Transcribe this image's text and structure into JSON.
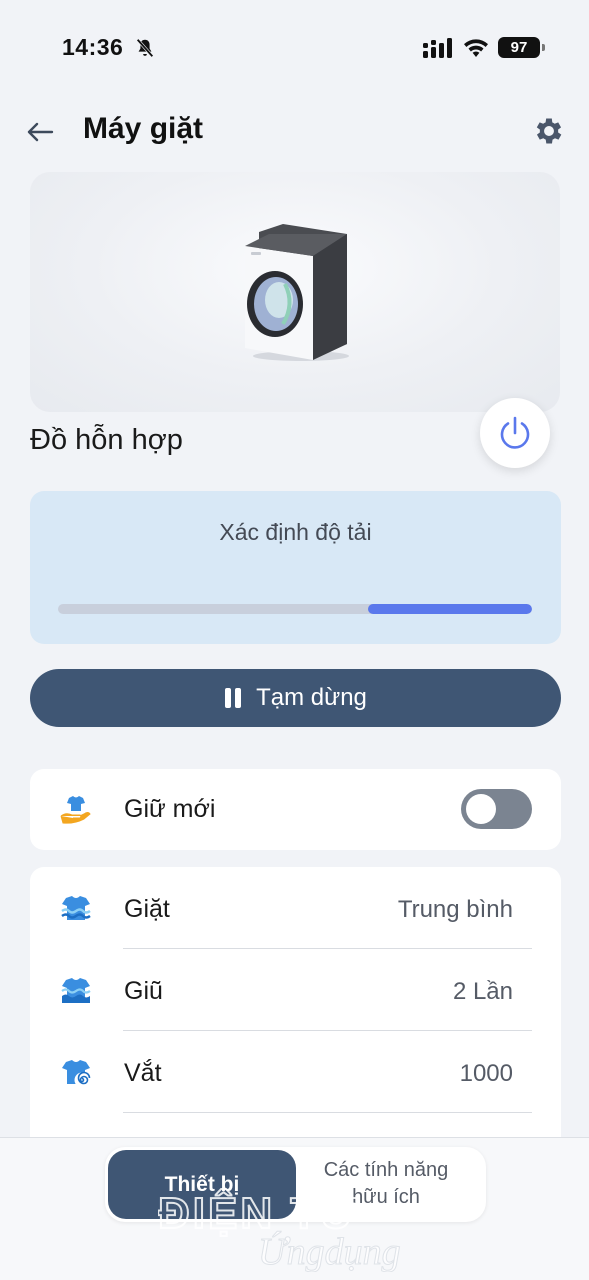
{
  "status_bar": {
    "time": "14:36",
    "battery": "97",
    "icons": [
      "bell-slash-icon",
      "signal-icon",
      "wifi-icon",
      "battery-icon"
    ]
  },
  "header": {
    "title": "Máy giặt",
    "back_icon": "arrow-left-icon",
    "settings_icon": "gear-icon"
  },
  "hero": {
    "image": "washing-machine-illustration"
  },
  "program": {
    "name": "Đồ hỗn hợp",
    "power_icon": "power-icon"
  },
  "progress": {
    "label": "Xác định độ tải",
    "segment_start": 0.655,
    "segment_end": 1.0,
    "colors": {
      "track": "#c8cfdc",
      "fill": "#5a78ec",
      "card": "#d8e8f6"
    }
  },
  "pause_button": {
    "label": "Tạm dừng",
    "icon": "pause-icon",
    "color": "#3f5674"
  },
  "keep_fresh": {
    "label": "Giữ mới",
    "icon": "hand-shirt-icon",
    "toggle_on": false
  },
  "settings": [
    {
      "label": "Giặt",
      "value": "Trung bình",
      "icon": "wash-icon"
    },
    {
      "label": "Giũ",
      "value": "2 Lần",
      "icon": "rinse-icon"
    },
    {
      "label": "Vắt",
      "value": "1000",
      "icon": "spin-icon"
    }
  ],
  "bottom_tabs": {
    "active": "Thiết bị",
    "other_line1": "Các tính năng",
    "other_line2": "hữu ích"
  },
  "watermark": {
    "line1": "ĐIỆN TỬ",
    "line2": "Ứngdụng"
  }
}
